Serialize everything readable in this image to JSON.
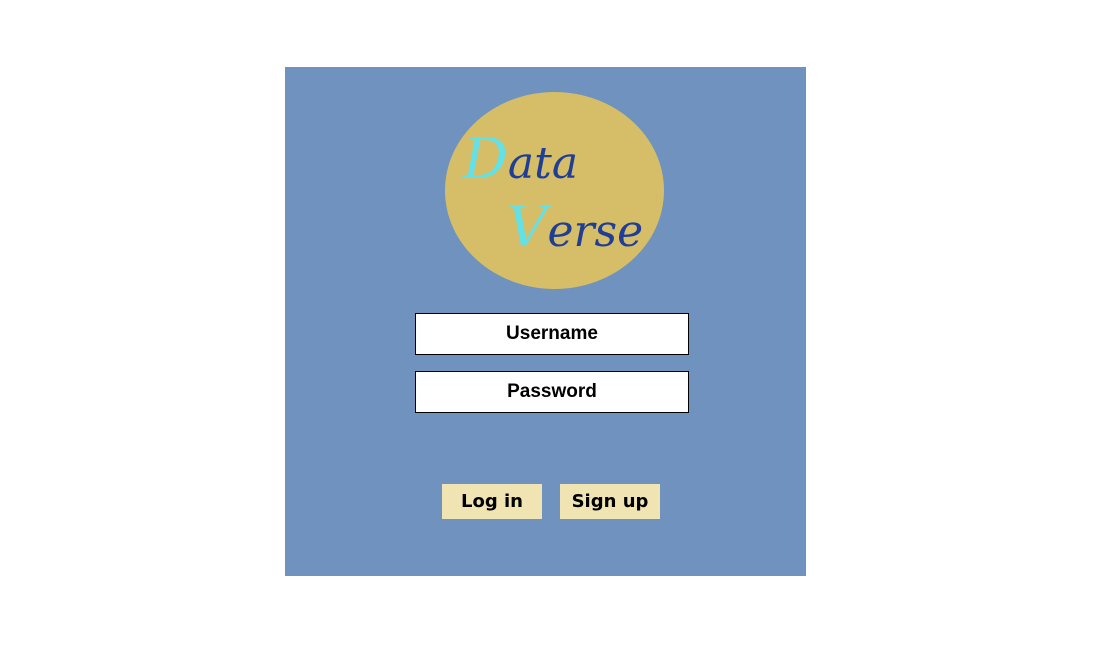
{
  "logo": {
    "line1": {
      "initial": "D",
      "rest": "ata"
    },
    "line2": {
      "initial": "V",
      "rest": "erse"
    },
    "colors": {
      "circle": "#d6bd68",
      "initial": "#62e2e8",
      "text": "#1f3f96"
    }
  },
  "form": {
    "username_placeholder": "Username",
    "password_placeholder": "Password",
    "login_label": "Log in",
    "signup_label": "Sign up"
  },
  "colors": {
    "panel_background": "#6f92bf",
    "button_background": "#f0e4b3"
  }
}
